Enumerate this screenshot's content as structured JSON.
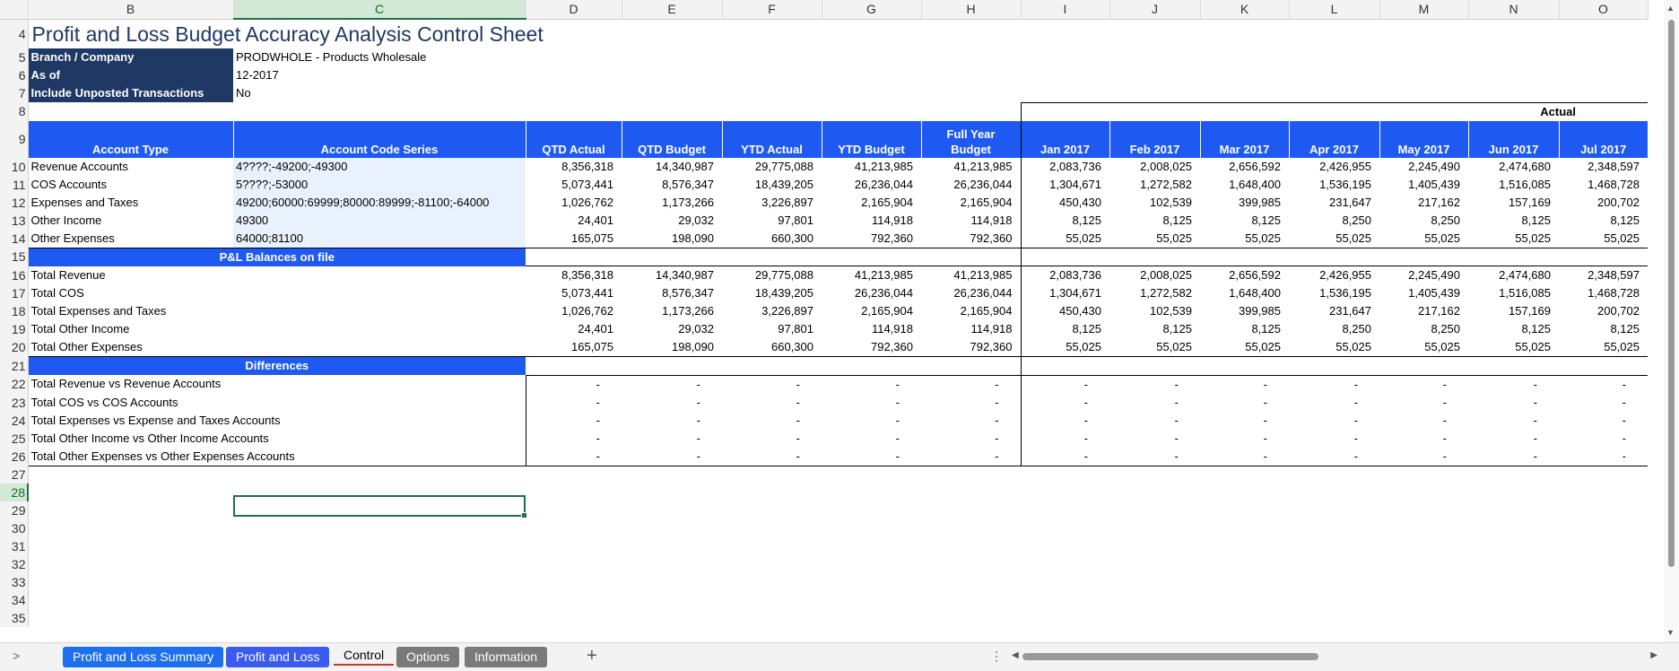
{
  "columns": [
    "B",
    "C",
    "D",
    "E",
    "F",
    "G",
    "H",
    "I",
    "J",
    "K",
    "L",
    "M",
    "N",
    "O"
  ],
  "row_numbers": {
    "r4": "4",
    "r5": "5",
    "r6": "6",
    "r7": "7",
    "r8": "8",
    "r9": "9",
    "r10": "10",
    "r11": "11",
    "r12": "12",
    "r13": "13",
    "r14": "14",
    "r15": "15",
    "r16": "16",
    "r17": "17",
    "r18": "18",
    "r19": "19",
    "r20": "20",
    "r21": "21",
    "r22": "22",
    "r23": "23",
    "r24": "24",
    "r25": "25",
    "r26": "26",
    "r27": "27",
    "r28": "28",
    "r29": "29",
    "r30": "30",
    "r31": "31",
    "r32": "32",
    "r33": "33",
    "r34": "34",
    "r35": "35"
  },
  "title": "Profit and Loss Budget Accuracy Analysis Control Sheet",
  "params": [
    {
      "label": "Branch / Company",
      "value": "PRODWHOLE - Products Wholesale"
    },
    {
      "label": "As of",
      "value": "12-2017"
    },
    {
      "label": "Include Unposted Transactions",
      "value": "No"
    }
  ],
  "actual_label": "Actual",
  "headers": {
    "account_type": "Account Type",
    "account_code_series": "Account Code Series",
    "qtd_actual": "QTD Actual",
    "qtd_budget": "QTD Budget",
    "ytd_actual": "YTD Actual",
    "ytd_budget": "YTD Budget",
    "full_year_line1": "Full Year",
    "full_year_line2": "Budget",
    "months": [
      "Jan 2017",
      "Feb 2017",
      "Mar 2017",
      "Apr 2017",
      "May 2017",
      "Jun 2017",
      "Jul 2017"
    ]
  },
  "accounts": [
    {
      "type": "Revenue Accounts",
      "code": "4????;-49200;-49300",
      "values": [
        "8,356,318",
        "14,340,987",
        "29,775,088",
        "41,213,985",
        "41,213,985",
        "2,083,736",
        "2,008,025",
        "2,656,592",
        "2,426,955",
        "2,245,490",
        "2,474,680",
        "2,348,597"
      ]
    },
    {
      "type": "COS Accounts",
      "code": "5????;-53000",
      "values": [
        "5,073,441",
        "8,576,347",
        "18,439,205",
        "26,236,044",
        "26,236,044",
        "1,304,671",
        "1,272,582",
        "1,648,400",
        "1,536,195",
        "1,405,439",
        "1,516,085",
        "1,468,728"
      ]
    },
    {
      "type": "Expenses and Taxes",
      "code": "49200;60000:69999;80000:89999;-81100;-64000",
      "values": [
        "1,026,762",
        "1,173,266",
        "3,226,897",
        "2,165,904",
        "2,165,904",
        "450,430",
        "102,539",
        "399,985",
        "231,647",
        "217,162",
        "157,169",
        "200,702"
      ]
    },
    {
      "type": "Other Income",
      "code": "49300",
      "values": [
        "24,401",
        "29,032",
        "97,801",
        "114,918",
        "114,918",
        "8,125",
        "8,125",
        "8,125",
        "8,250",
        "8,250",
        "8,125",
        "8,125"
      ]
    },
    {
      "type": "Other Expenses",
      "code": "64000;81100",
      "values": [
        "165,075",
        "198,090",
        "660,300",
        "792,360",
        "792,360",
        "55,025",
        "55,025",
        "55,025",
        "55,025",
        "55,025",
        "55,025",
        "55,025"
      ]
    }
  ],
  "section_balances": "P&L Balances on file",
  "totals": [
    {
      "label": "Total Revenue",
      "values": [
        "8,356,318",
        "14,340,987",
        "29,775,088",
        "41,213,985",
        "41,213,985",
        "2,083,736",
        "2,008,025",
        "2,656,592",
        "2,426,955",
        "2,245,490",
        "2,474,680",
        "2,348,597"
      ]
    },
    {
      "label": "Total COS",
      "values": [
        "5,073,441",
        "8,576,347",
        "18,439,205",
        "26,236,044",
        "26,236,044",
        "1,304,671",
        "1,272,582",
        "1,648,400",
        "1,536,195",
        "1,405,439",
        "1,516,085",
        "1,468,728"
      ]
    },
    {
      "label": "Total Expenses and Taxes",
      "values": [
        "1,026,762",
        "1,173,266",
        "3,226,897",
        "2,165,904",
        "2,165,904",
        "450,430",
        "102,539",
        "399,985",
        "231,647",
        "217,162",
        "157,169",
        "200,702"
      ]
    },
    {
      "label": "Total Other Income",
      "values": [
        "24,401",
        "29,032",
        "97,801",
        "114,918",
        "114,918",
        "8,125",
        "8,125",
        "8,125",
        "8,250",
        "8,250",
        "8,125",
        "8,125"
      ]
    },
    {
      "label": "Total Other Expenses",
      "values": [
        "165,075",
        "198,090",
        "660,300",
        "792,360",
        "792,360",
        "55,025",
        "55,025",
        "55,025",
        "55,025",
        "55,025",
        "55,025",
        "55,025"
      ]
    }
  ],
  "section_differences": "Differences",
  "differences": [
    {
      "label": "Total Revenue vs Revenue Accounts",
      "values": [
        "-",
        "-",
        "-",
        "-",
        "-",
        "-",
        "-",
        "-",
        "-",
        "-",
        "-",
        "-"
      ]
    },
    {
      "label": "Total COS vs COS Accounts",
      "values": [
        "-",
        "-",
        "-",
        "-",
        "-",
        "-",
        "-",
        "-",
        "-",
        "-",
        "-",
        "-"
      ]
    },
    {
      "label": "Total Expenses vs Expense and Taxes Accounts",
      "values": [
        "-",
        "-",
        "-",
        "-",
        "-",
        "-",
        "-",
        "-",
        "-",
        "-",
        "-",
        "-"
      ]
    },
    {
      "label": "Total Other Income vs Other Income Accounts",
      "values": [
        "-",
        "-",
        "-",
        "-",
        "-",
        "-",
        "-",
        "-",
        "-",
        "-",
        "-",
        "-"
      ]
    },
    {
      "label": "Total Other Expenses vs Other Expenses Accounts",
      "values": [
        "-",
        "-",
        "-",
        "-",
        "-",
        "-",
        "-",
        "-",
        "-",
        "-",
        "-",
        "-"
      ]
    }
  ],
  "tabs": {
    "t1": "Profit and Loss Summary",
    "t2": "Profit and Loss",
    "t3": "Control",
    "t4": "Options",
    "t5": "Information"
  },
  "tab_add": "+",
  "tab_nav": ">",
  "tab_dots": "⋮",
  "colors": {
    "navy": "#1f3864",
    "blue": "#1e5af2",
    "code_fill": "#e8f1fc",
    "selection": "#1e7145"
  }
}
